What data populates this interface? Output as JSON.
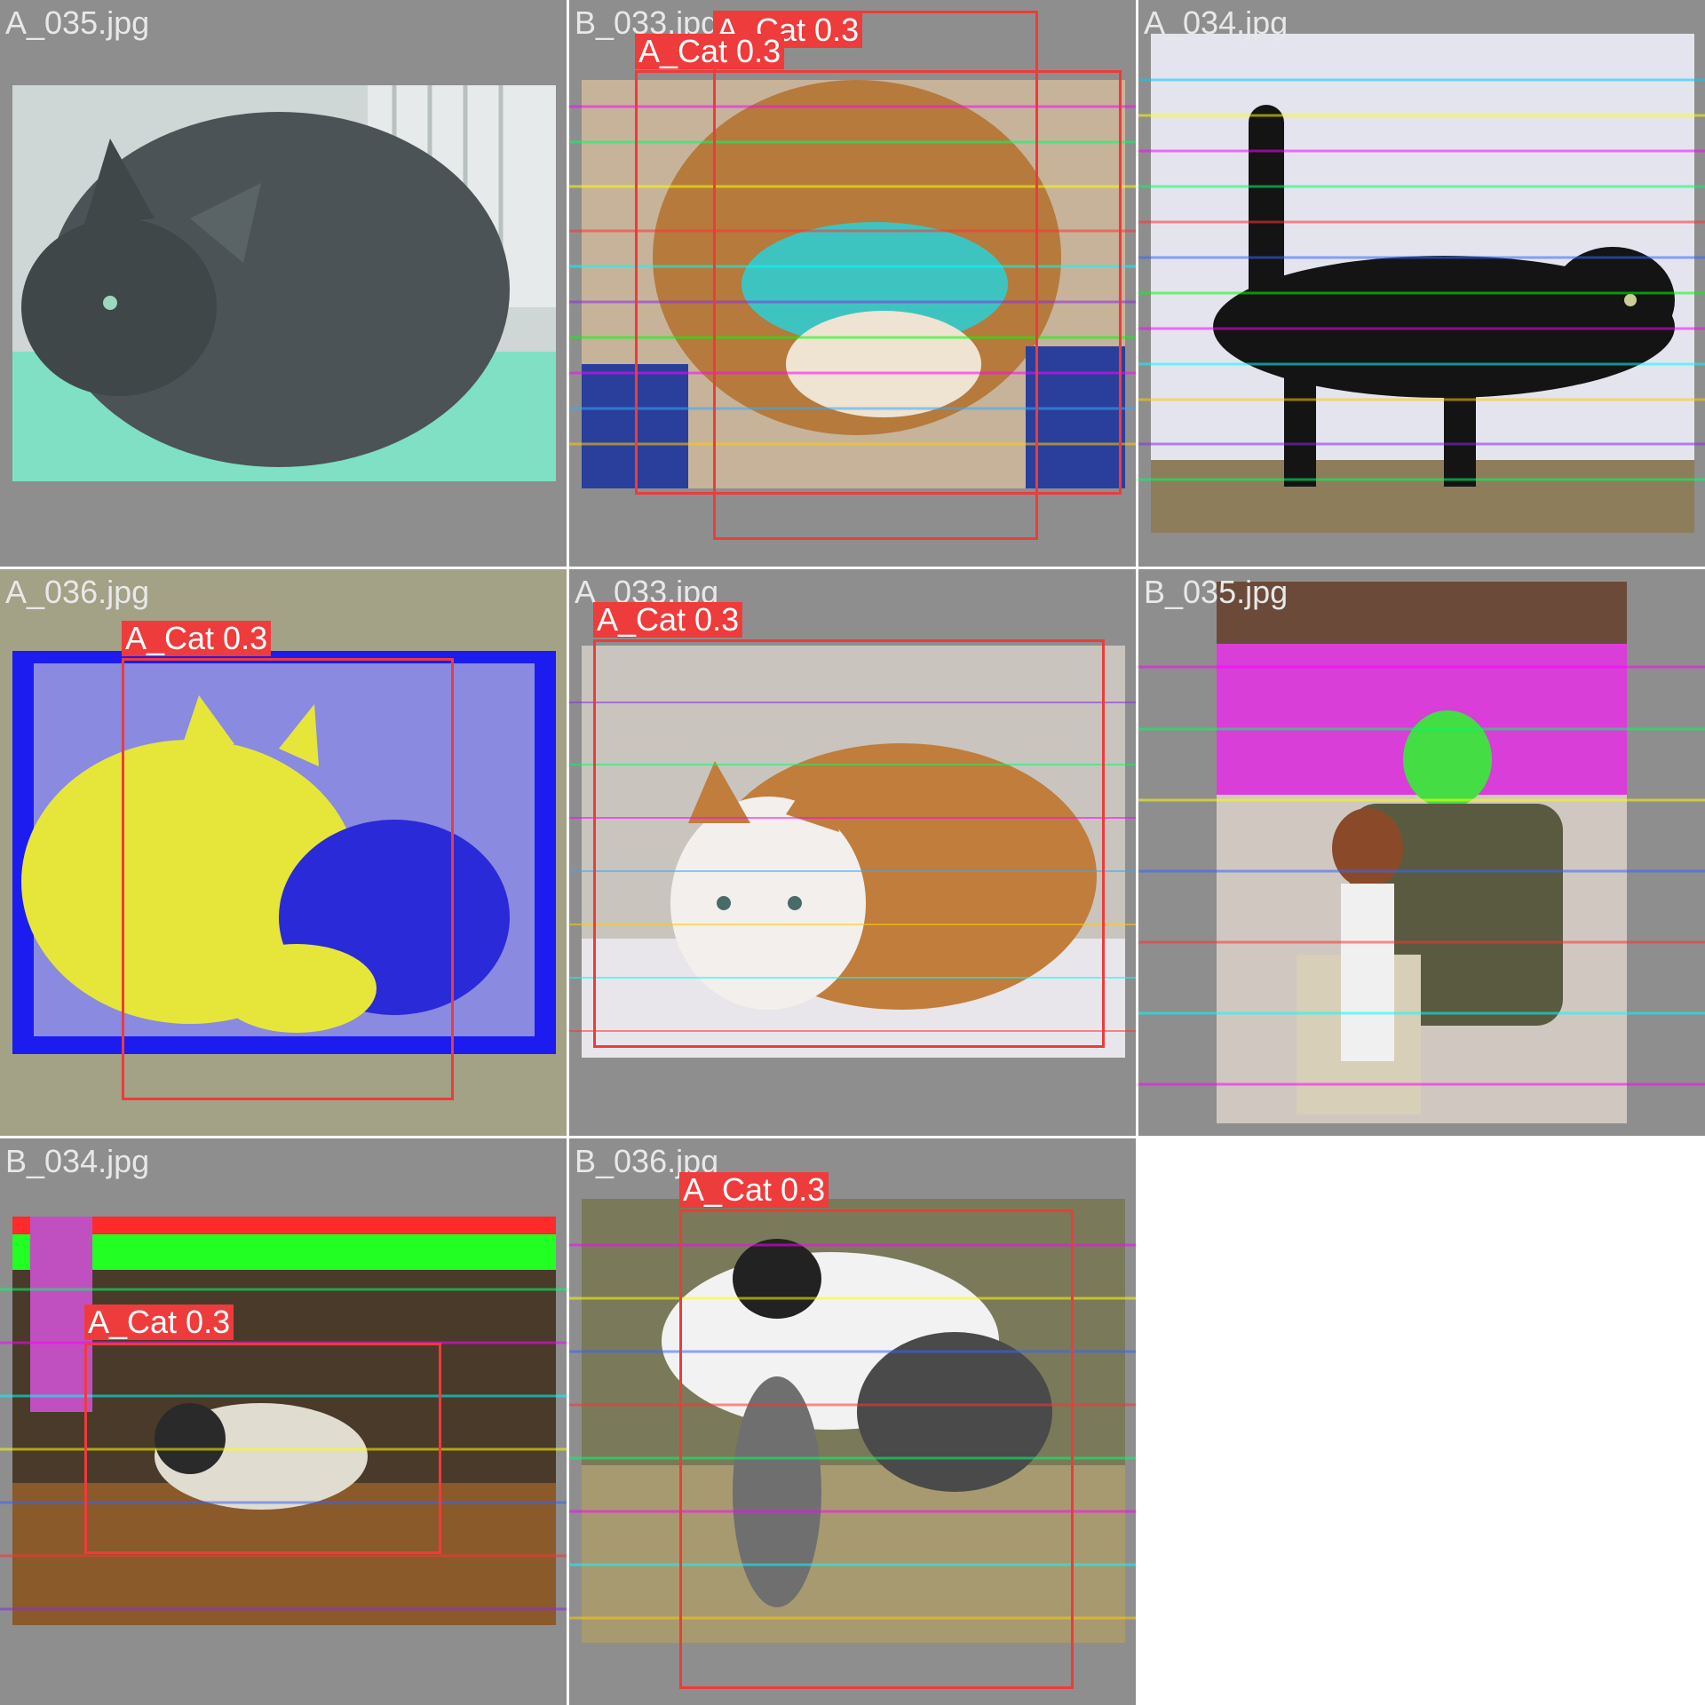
{
  "tiles": [
    {
      "filename": "A_035.jpg",
      "detections": []
    },
    {
      "filename": "B_033.jpg",
      "detections": [
        {
          "label": "A_Cat 0.3"
        },
        {
          "label": "A_Cat 0.3"
        }
      ]
    },
    {
      "filename": "A_034.jpg",
      "detections": []
    },
    {
      "filename": "A_036.jpg",
      "detections": [
        {
          "label": "A_Cat 0.3"
        }
      ]
    },
    {
      "filename": "A_033.jpg",
      "detections": [
        {
          "label": "A_Cat 0.3"
        }
      ]
    },
    {
      "filename": "B_035.jpg",
      "detections": []
    },
    {
      "filename": "B_034.jpg",
      "detections": [
        {
          "label": "A_Cat 0.3"
        }
      ]
    },
    {
      "filename": "B_036.jpg",
      "detections": [
        {
          "label": "A_Cat 0.3"
        }
      ]
    }
  ],
  "colors": {
    "box": "#ee3b3b",
    "letterbox": "#8e8e8e",
    "filename_text": "#e8e8e8"
  }
}
